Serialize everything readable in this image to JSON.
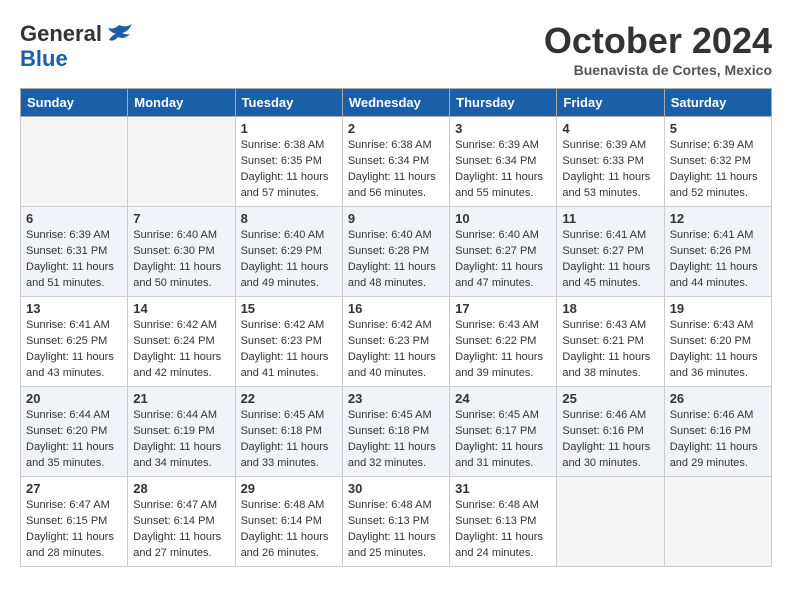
{
  "header": {
    "logo_line1": "General",
    "logo_line2": "Blue",
    "month": "October 2024",
    "location": "Buenavista de Cortes, Mexico"
  },
  "days_of_week": [
    "Sunday",
    "Monday",
    "Tuesday",
    "Wednesday",
    "Thursday",
    "Friday",
    "Saturday"
  ],
  "weeks": [
    [
      {
        "day": "",
        "info": ""
      },
      {
        "day": "",
        "info": ""
      },
      {
        "day": "1",
        "info": "Sunrise: 6:38 AM\nSunset: 6:35 PM\nDaylight: 11 hours and 57 minutes."
      },
      {
        "day": "2",
        "info": "Sunrise: 6:38 AM\nSunset: 6:34 PM\nDaylight: 11 hours and 56 minutes."
      },
      {
        "day": "3",
        "info": "Sunrise: 6:39 AM\nSunset: 6:34 PM\nDaylight: 11 hours and 55 minutes."
      },
      {
        "day": "4",
        "info": "Sunrise: 6:39 AM\nSunset: 6:33 PM\nDaylight: 11 hours and 53 minutes."
      },
      {
        "day": "5",
        "info": "Sunrise: 6:39 AM\nSunset: 6:32 PM\nDaylight: 11 hours and 52 minutes."
      }
    ],
    [
      {
        "day": "6",
        "info": "Sunrise: 6:39 AM\nSunset: 6:31 PM\nDaylight: 11 hours and 51 minutes."
      },
      {
        "day": "7",
        "info": "Sunrise: 6:40 AM\nSunset: 6:30 PM\nDaylight: 11 hours and 50 minutes."
      },
      {
        "day": "8",
        "info": "Sunrise: 6:40 AM\nSunset: 6:29 PM\nDaylight: 11 hours and 49 minutes."
      },
      {
        "day": "9",
        "info": "Sunrise: 6:40 AM\nSunset: 6:28 PM\nDaylight: 11 hours and 48 minutes."
      },
      {
        "day": "10",
        "info": "Sunrise: 6:40 AM\nSunset: 6:27 PM\nDaylight: 11 hours and 47 minutes."
      },
      {
        "day": "11",
        "info": "Sunrise: 6:41 AM\nSunset: 6:27 PM\nDaylight: 11 hours and 45 minutes."
      },
      {
        "day": "12",
        "info": "Sunrise: 6:41 AM\nSunset: 6:26 PM\nDaylight: 11 hours and 44 minutes."
      }
    ],
    [
      {
        "day": "13",
        "info": "Sunrise: 6:41 AM\nSunset: 6:25 PM\nDaylight: 11 hours and 43 minutes."
      },
      {
        "day": "14",
        "info": "Sunrise: 6:42 AM\nSunset: 6:24 PM\nDaylight: 11 hours and 42 minutes."
      },
      {
        "day": "15",
        "info": "Sunrise: 6:42 AM\nSunset: 6:23 PM\nDaylight: 11 hours and 41 minutes."
      },
      {
        "day": "16",
        "info": "Sunrise: 6:42 AM\nSunset: 6:23 PM\nDaylight: 11 hours and 40 minutes."
      },
      {
        "day": "17",
        "info": "Sunrise: 6:43 AM\nSunset: 6:22 PM\nDaylight: 11 hours and 39 minutes."
      },
      {
        "day": "18",
        "info": "Sunrise: 6:43 AM\nSunset: 6:21 PM\nDaylight: 11 hours and 38 minutes."
      },
      {
        "day": "19",
        "info": "Sunrise: 6:43 AM\nSunset: 6:20 PM\nDaylight: 11 hours and 36 minutes."
      }
    ],
    [
      {
        "day": "20",
        "info": "Sunrise: 6:44 AM\nSunset: 6:20 PM\nDaylight: 11 hours and 35 minutes."
      },
      {
        "day": "21",
        "info": "Sunrise: 6:44 AM\nSunset: 6:19 PM\nDaylight: 11 hours and 34 minutes."
      },
      {
        "day": "22",
        "info": "Sunrise: 6:45 AM\nSunset: 6:18 PM\nDaylight: 11 hours and 33 minutes."
      },
      {
        "day": "23",
        "info": "Sunrise: 6:45 AM\nSunset: 6:18 PM\nDaylight: 11 hours and 32 minutes."
      },
      {
        "day": "24",
        "info": "Sunrise: 6:45 AM\nSunset: 6:17 PM\nDaylight: 11 hours and 31 minutes."
      },
      {
        "day": "25",
        "info": "Sunrise: 6:46 AM\nSunset: 6:16 PM\nDaylight: 11 hours and 30 minutes."
      },
      {
        "day": "26",
        "info": "Sunrise: 6:46 AM\nSunset: 6:16 PM\nDaylight: 11 hours and 29 minutes."
      }
    ],
    [
      {
        "day": "27",
        "info": "Sunrise: 6:47 AM\nSunset: 6:15 PM\nDaylight: 11 hours and 28 minutes."
      },
      {
        "day": "28",
        "info": "Sunrise: 6:47 AM\nSunset: 6:14 PM\nDaylight: 11 hours and 27 minutes."
      },
      {
        "day": "29",
        "info": "Sunrise: 6:48 AM\nSunset: 6:14 PM\nDaylight: 11 hours and 26 minutes."
      },
      {
        "day": "30",
        "info": "Sunrise: 6:48 AM\nSunset: 6:13 PM\nDaylight: 11 hours and 25 minutes."
      },
      {
        "day": "31",
        "info": "Sunrise: 6:48 AM\nSunset: 6:13 PM\nDaylight: 11 hours and 24 minutes."
      },
      {
        "day": "",
        "info": ""
      },
      {
        "day": "",
        "info": ""
      }
    ]
  ]
}
